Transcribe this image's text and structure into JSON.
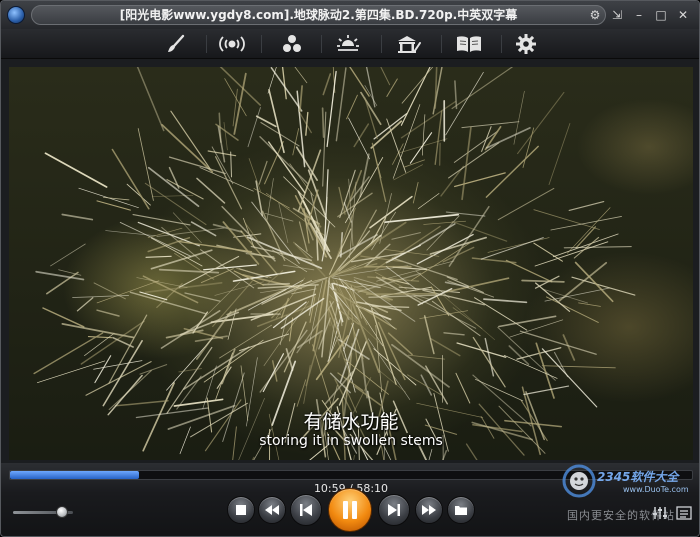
{
  "window": {
    "title": "[阳光电影www.ygdy8.com].地球脉动2.第四集.BD.720p.中英双字幕",
    "controls": {
      "settings": "⚙",
      "restore": "⇲",
      "minimize": "–",
      "maximize": "□",
      "close": "✕"
    }
  },
  "toolbar": {
    "items": [
      {
        "name": "skin-brush-icon"
      },
      {
        "name": "audio-icon"
      },
      {
        "name": "effects-icon"
      },
      {
        "name": "brightness-icon"
      },
      {
        "name": "screenshot-icon"
      },
      {
        "name": "playlist-book-icon"
      },
      {
        "name": "gear-icon"
      }
    ]
  },
  "video": {
    "subtitle_cn": "有储水功能",
    "subtitle_en": "storing it in swollen stems"
  },
  "playback": {
    "time_text": "10:59 / 58:10",
    "progress_fraction": 0.189,
    "volume_fraction": 0.82
  },
  "watermark": {
    "brand": "2345软件大全",
    "url": "www.DuoTe.com",
    "tagline": "国内更安全的软件站"
  },
  "colors": {
    "accent": "#2763c6",
    "play_button": "#f28a10"
  }
}
